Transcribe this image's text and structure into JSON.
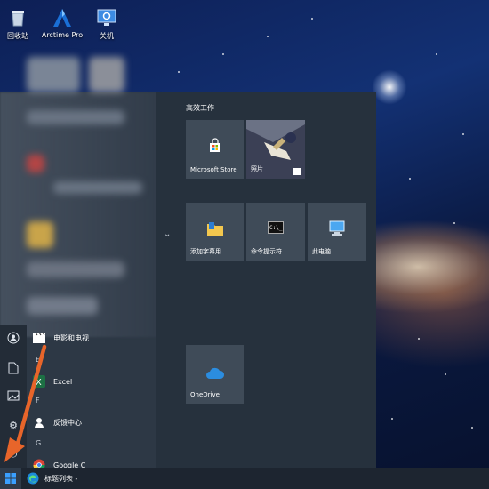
{
  "desktop": {
    "icons": [
      {
        "label": "回收站",
        "icon": "recycle-bin-icon"
      },
      {
        "label": "Arctime Pro",
        "icon": "arctime-icon"
      },
      {
        "label": "关机",
        "icon": "shutdown-icon"
      }
    ]
  },
  "start_menu": {
    "group_title": "高效工作",
    "tiles": [
      {
        "label": "Microsoft Store",
        "icon": "store-icon"
      },
      {
        "label": "照片",
        "icon": "photos-icon"
      },
      {
        "label": "添加字幕用",
        "icon": "folder-icon"
      },
      {
        "label": "命令提示符",
        "icon": "cmd-icon"
      },
      {
        "label": "此电脑",
        "icon": "computer-icon"
      },
      {
        "label": "OneDrive",
        "icon": "cloud-icon"
      }
    ],
    "app_list": [
      {
        "label": "电影和电视",
        "icon": "movies-icon"
      },
      {
        "letter": "E"
      },
      {
        "label": "Excel",
        "icon": "excel-icon"
      },
      {
        "letter": "F"
      },
      {
        "label": "反馈中心",
        "icon": "feedback-icon"
      },
      {
        "letter": "G"
      },
      {
        "label": "Google C",
        "icon": "chrome-icon"
      }
    ],
    "rail": [
      "user-icon",
      "document-icon",
      "pictures-icon",
      "settings-icon",
      "power-icon"
    ]
  },
  "taskbar": {
    "start_icon": "windows-logo-icon",
    "edge_label": "标题列表 -",
    "edge_icon": "edge-icon"
  },
  "colors": {
    "tile": "#3f4b58",
    "menu": "#2d3845",
    "arrow": "#e8652a",
    "onedrive": "#2b8de0"
  }
}
